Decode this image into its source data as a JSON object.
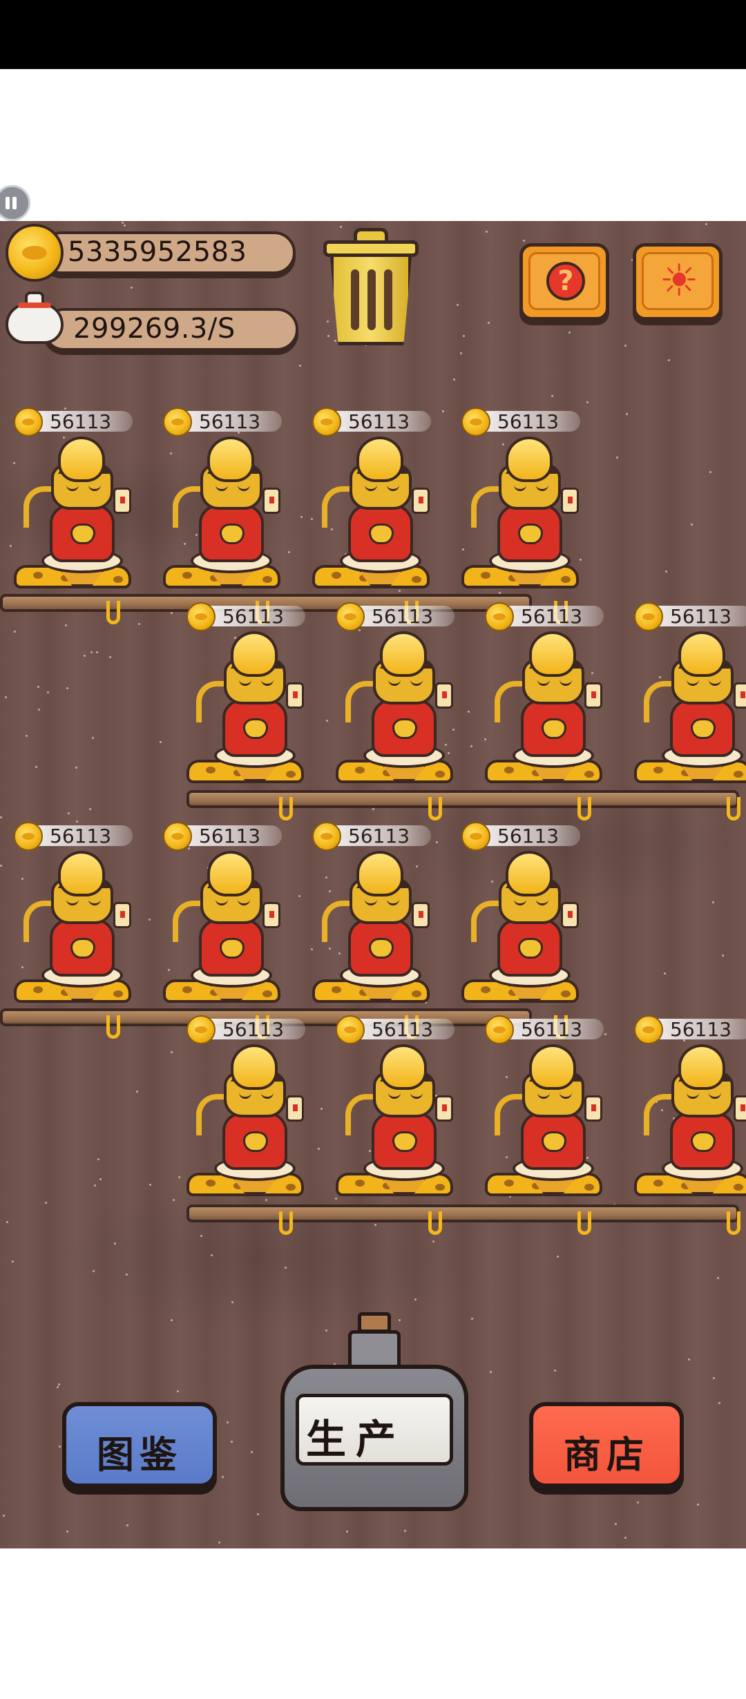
{
  "hud": {
    "coins": "5335952583",
    "rate": "299269.3/S"
  },
  "income_label": "56113",
  "buttons": {
    "catalog": "图鉴",
    "produce": "生产",
    "shop": "商店"
  },
  "icons": {
    "help": "question-mark-icon",
    "settings": "gear-icon",
    "trash": "trash-can-icon"
  },
  "colors": {
    "wood_bg": "#6c4f49",
    "orange_button": "#f19a26",
    "blue_button": "#5a7bc8",
    "red_button": "#f2553c",
    "gold": "#f4b81a"
  },
  "cats": [
    {
      "row": 1,
      "slot": 1,
      "income": "56113"
    },
    {
      "row": 1,
      "slot": 2,
      "income": "56113"
    },
    {
      "row": 1,
      "slot": 3,
      "income": "56113"
    },
    {
      "row": 1,
      "slot": 4,
      "income": "56113"
    },
    {
      "row": 2,
      "slot": 1,
      "income": "56113"
    },
    {
      "row": 2,
      "slot": 2,
      "income": "56113"
    },
    {
      "row": 2,
      "slot": 3,
      "income": "56113"
    },
    {
      "row": 2,
      "slot": 4,
      "income": "56113"
    },
    {
      "row": 3,
      "slot": 1,
      "income": "56113"
    },
    {
      "row": 3,
      "slot": 2,
      "income": "56113"
    },
    {
      "row": 3,
      "slot": 3,
      "income": "56113"
    },
    {
      "row": 3,
      "slot": 4,
      "income": "56113"
    },
    {
      "row": 4,
      "slot": 1,
      "income": "56113"
    },
    {
      "row": 4,
      "slot": 2,
      "income": "56113"
    },
    {
      "row": 4,
      "slot": 3,
      "income": "56113"
    },
    {
      "row": 4,
      "slot": 4,
      "income": "56113"
    }
  ]
}
